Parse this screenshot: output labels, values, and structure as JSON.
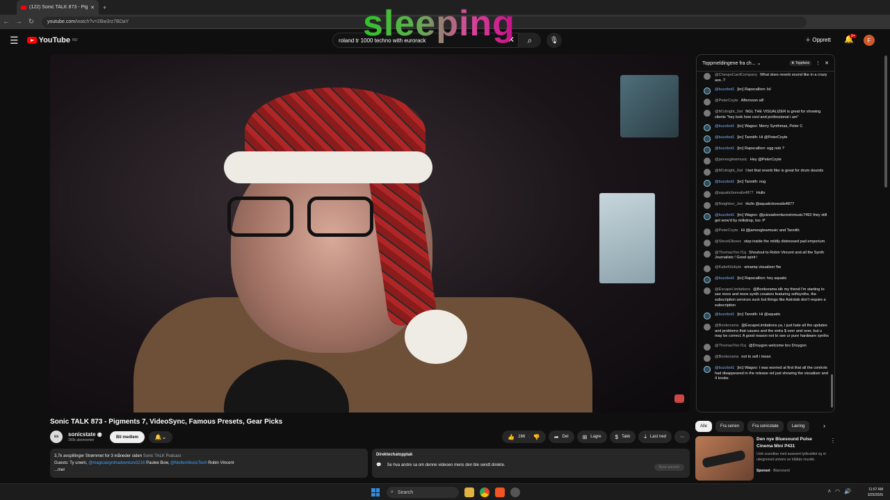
{
  "browser": {
    "tab_title": "(122) Sonic TALK 873 - Pigm",
    "url_domain": "youtube.com",
    "url_path": "/watch?v=2Bw3rz7BDaY"
  },
  "header": {
    "logo_text": "YouTube",
    "logo_region": "NO",
    "search_value": "roland tr 1000 techno with eurorack",
    "create_label": "Opprett",
    "notif_badge": "9+",
    "avatar_letter": "F"
  },
  "overlay": {
    "text": "sleeping"
  },
  "video": {
    "title": "Sonic TALK 873 - Pigments 7, VideoSync, Famous Presets, Gear Picks",
    "channel_name": "sonicstate",
    "subscribers": "260k abonnenter",
    "member_label": "Bli medlem",
    "likes": "166",
    "share_label": "Del",
    "save_label": "Lagre",
    "thanks_label": "Takk",
    "download_label": "Last ned"
  },
  "description": {
    "stats": "3,7k avspillinger  Strømmet for 3 måneder siden",
    "podcast": "Sonic TALK Podcast",
    "guests_prefix": "Guests: Ty unwin,",
    "guest_link1": "@magicalsynthadventure3216",
    "guest_mid": "Paulee Bow,",
    "guest_link2": "@MoltenMusicTech",
    "guest_last": "Robin Vincent",
    "more": "...mer"
  },
  "replay": {
    "title": "Direktechatopptak",
    "text": "Se hva andre sa om denne videoen mens den ble sendt direkte.",
    "cta": "Åpne panelet"
  },
  "chat": {
    "header_title": "Toppmeldingene fra ch...",
    "fan_label": "Toppfans",
    "messages": [
      {
        "author": "@ChespoCardCompany",
        "text": "What does reverb sound like in a crazy ass..?",
        "bot": false
      },
      {
        "author": "@buzzbot1",
        "text": "[irc] Rapscallion: lol",
        "bot": true
      },
      {
        "author": "@PeterCoyte",
        "text": "Afternoon all!",
        "bot": false
      },
      {
        "author": "@M1dnight_0wl",
        "text": "NGL THE VISUALIZER is great for showing clients \"hey look how cool and professional i am\"",
        "bot": false
      },
      {
        "author": "@buzzbot1",
        "text": "[irc] Wagoo: Merry Synthmas, Peter C",
        "bot": true
      },
      {
        "author": "@buzzbot1",
        "text": "[irc] Tannith: Hi @PeterCoyte",
        "bot": true
      },
      {
        "author": "@buzzbot1",
        "text": "[irc] Rapscallion: egg nob ?",
        "bot": true
      },
      {
        "author": "@jamesglewmusic",
        "text": "Hey @PeterCoyte",
        "bot": false
      },
      {
        "author": "@M1dnight_0wl",
        "text": "I bet that reverb filer is great for drum dounds",
        "bot": false
      },
      {
        "author": "@buzzbot1",
        "text": "[irc] Tannith: nog",
        "bot": true
      },
      {
        "author": "@aquaticborealis4877",
        "text": "Hullo",
        "bot": false
      },
      {
        "author": "@Neighbor_Jek",
        "text": "Hullo @aquaticborealis4877",
        "bot": false
      },
      {
        "author": "@buzzbot1",
        "text": "[irc] Wagoo: @julzsadventuresinmusic7492 they still get wow'd by milkdrop, too :P",
        "bot": true
      },
      {
        "author": "@PeterCoyte",
        "text": "Hi @jamesglewmusic and Tannith",
        "bot": false
      },
      {
        "author": "@SteveElbows",
        "text": "step inside the mildly distressed pad emporium",
        "bot": false
      },
      {
        "author": "@ThomasYon-f1q",
        "text": "Shoutout to Robin Vincent and all the Synth Journalists ! Good spirit !",
        "bot": false
      },
      {
        "author": "@KatieKilobyte",
        "text": "winamp visualizer ftw",
        "bot": false
      },
      {
        "author": "@buzzbot1",
        "text": "[irc] Rapscallion: hey aquatic",
        "bot": true
      },
      {
        "author": "@EscapeLimitations",
        "text": "@Bonkorama idk my friend I'm starting to see more and more synth creators featuring softsynths. the subscription services suck but things like Astrolab don't require a subscription",
        "bot": false
      },
      {
        "author": "@buzzbot1",
        "text": "[irc] Tannith: Hi @aquatic",
        "bot": true
      },
      {
        "author": "@Bonkorama",
        "text": "@EscapeLimitations ya, i just hate all the updates and problems that causes and the extra $ over and over, but u may be correct. A good reason not to see ur pure hardware synths",
        "bot": false
      },
      {
        "author": "@ThomasYon-f1q",
        "text": "@Droygon welcome bro Droygon",
        "bot": false
      },
      {
        "author": "@Bonkorama",
        "text": "not to sell i mean",
        "bot": false
      },
      {
        "author": "@buzzbot1",
        "text": "[irc] Wagoo: I was worried at first that all the controls had disappeared in the release vid just showing the visualiser and 4 knobs",
        "bot": true
      }
    ]
  },
  "chips": [
    "Alle",
    "Fra serien",
    "Fra sonicstate",
    "Læring"
  ],
  "recommendation": {
    "title": "Den nye Bluesound Pulse Cinema Mini P431",
    "desc": "Unik soundbar med avansert lydkvalitet og et ubegrenset univers av trådløs musikk.",
    "sponsored": "Sponset",
    "advertiser": "Bluesound"
  },
  "taskbar": {
    "search_label": "Search",
    "time": "11:57 AM",
    "date": "3/25/2026"
  }
}
